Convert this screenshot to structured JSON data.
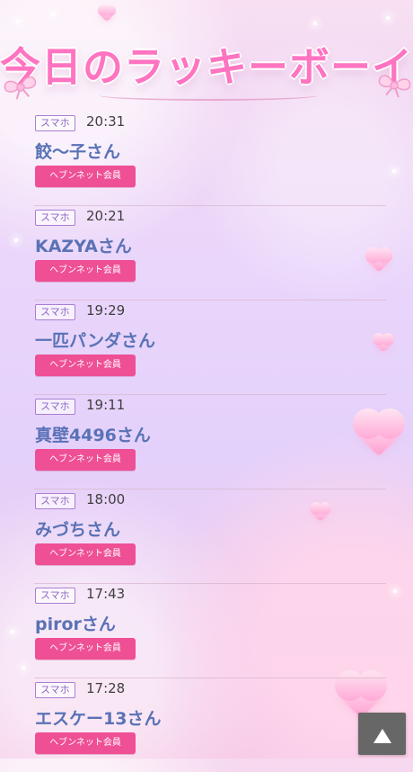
{
  "page": {
    "title": "今日のラッキーボーイ"
  },
  "lucky_boys": [
    {
      "device": "スマホ",
      "time": "20:31",
      "name": "餃〜子さん",
      "member_label": "ヘブンネット会員"
    },
    {
      "device": "スマホ",
      "time": "20:21",
      "name": "KAZYAさん",
      "member_label": "ヘブンネット会員"
    },
    {
      "device": "スマホ",
      "time": "19:29",
      "name": "一匹パンダさん",
      "member_label": "ヘブンネット会員"
    },
    {
      "device": "スマホ",
      "time": "19:11",
      "name": "真壁4496さん",
      "member_label": "ヘブンネット会員"
    },
    {
      "device": "スマホ",
      "time": "18:00",
      "name": "みづちさん",
      "member_label": "ヘブンネット会員"
    },
    {
      "device": "スマホ",
      "time": "17:43",
      "name": "pirorさん",
      "member_label": "ヘブンネット会員"
    },
    {
      "device": "スマホ",
      "time": "17:28",
      "name": "エスケー13さん",
      "member_label": "ヘブンネット会員"
    }
  ],
  "controls": {
    "back_to_top_icon": "up-triangle-icon"
  },
  "colors": {
    "title_pink": "#ff74c1",
    "badge_purple": "#8d68c2",
    "name_blue": "#5a72b6",
    "member_pink": "#ef4f95",
    "top_button_gray": "#676767"
  }
}
